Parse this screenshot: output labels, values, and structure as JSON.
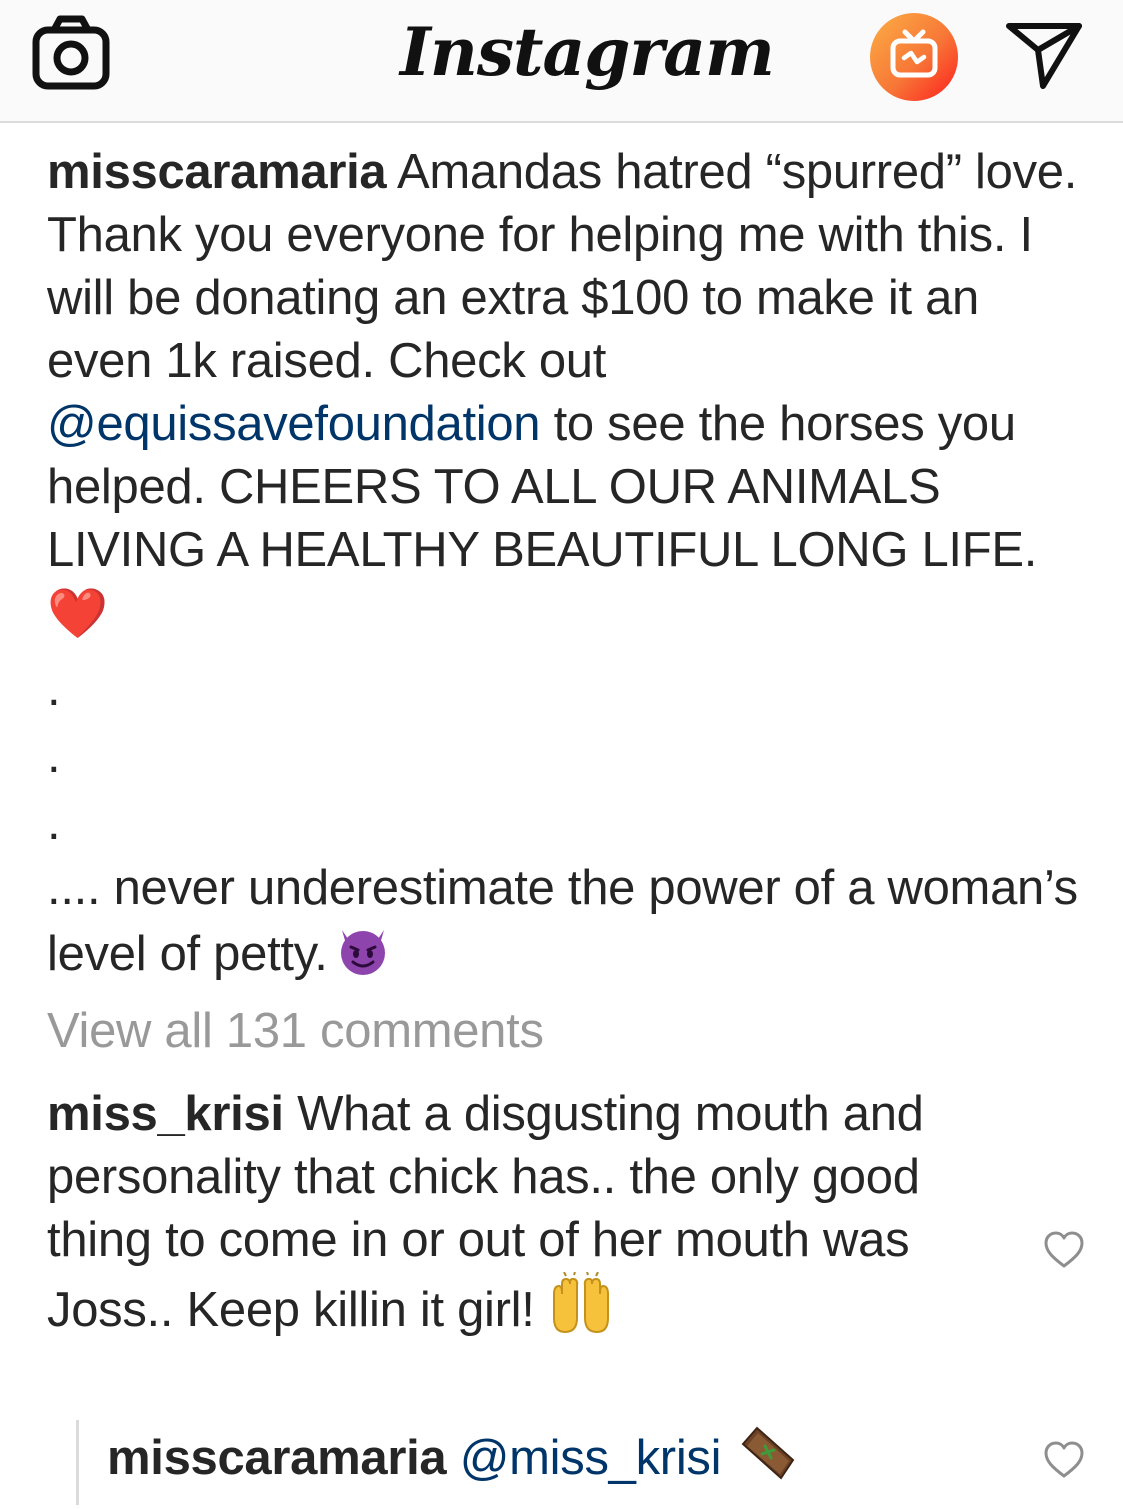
{
  "header": {
    "logo_text": "Instagram",
    "icons": {
      "camera": "camera-icon",
      "igtv": "igtv-icon",
      "direct": "direct-message-icon"
    },
    "colors": {
      "igtv_gradient_start": "#f77737",
      "igtv_gradient_end": "#fd1d1d"
    }
  },
  "post": {
    "caption": {
      "username": "misscaramaria",
      "text_before_mention": "Amandas hatred “spurred” love. Thank you everyone for helping me with this. I will be donating an extra $100 to make it an even 1k raised. Check out",
      "mention": "@equissavefoundation",
      "text_after_mention": "to see the horses you helped. CHEERS TO ALL OUR ANIMALS LIVING A HEALTHY BEAUTIFUL LONG LIFE.",
      "emoji_1": "❤️",
      "dot_1": ".",
      "dot_2": ".",
      "dot_3": ".",
      "tail_text": ".... never underestimate the power of a woman’s level of petty.",
      "emoji_2_icon": "smiling-devil-emoji"
    },
    "view_all_comments": "View all 131 comments",
    "comments": [
      {
        "username": "miss_krisi",
        "text": "What a disgusting mouth and personality that chick has.. the only good thing to come in or out of her mouth was Joss.. Keep killin it girl!",
        "emoji_icon": "raising-hands-emoji"
      }
    ],
    "reply": {
      "username": "misscaramaria",
      "mention": "@miss_krisi",
      "emoji_icon": "coffin-emoji"
    }
  }
}
